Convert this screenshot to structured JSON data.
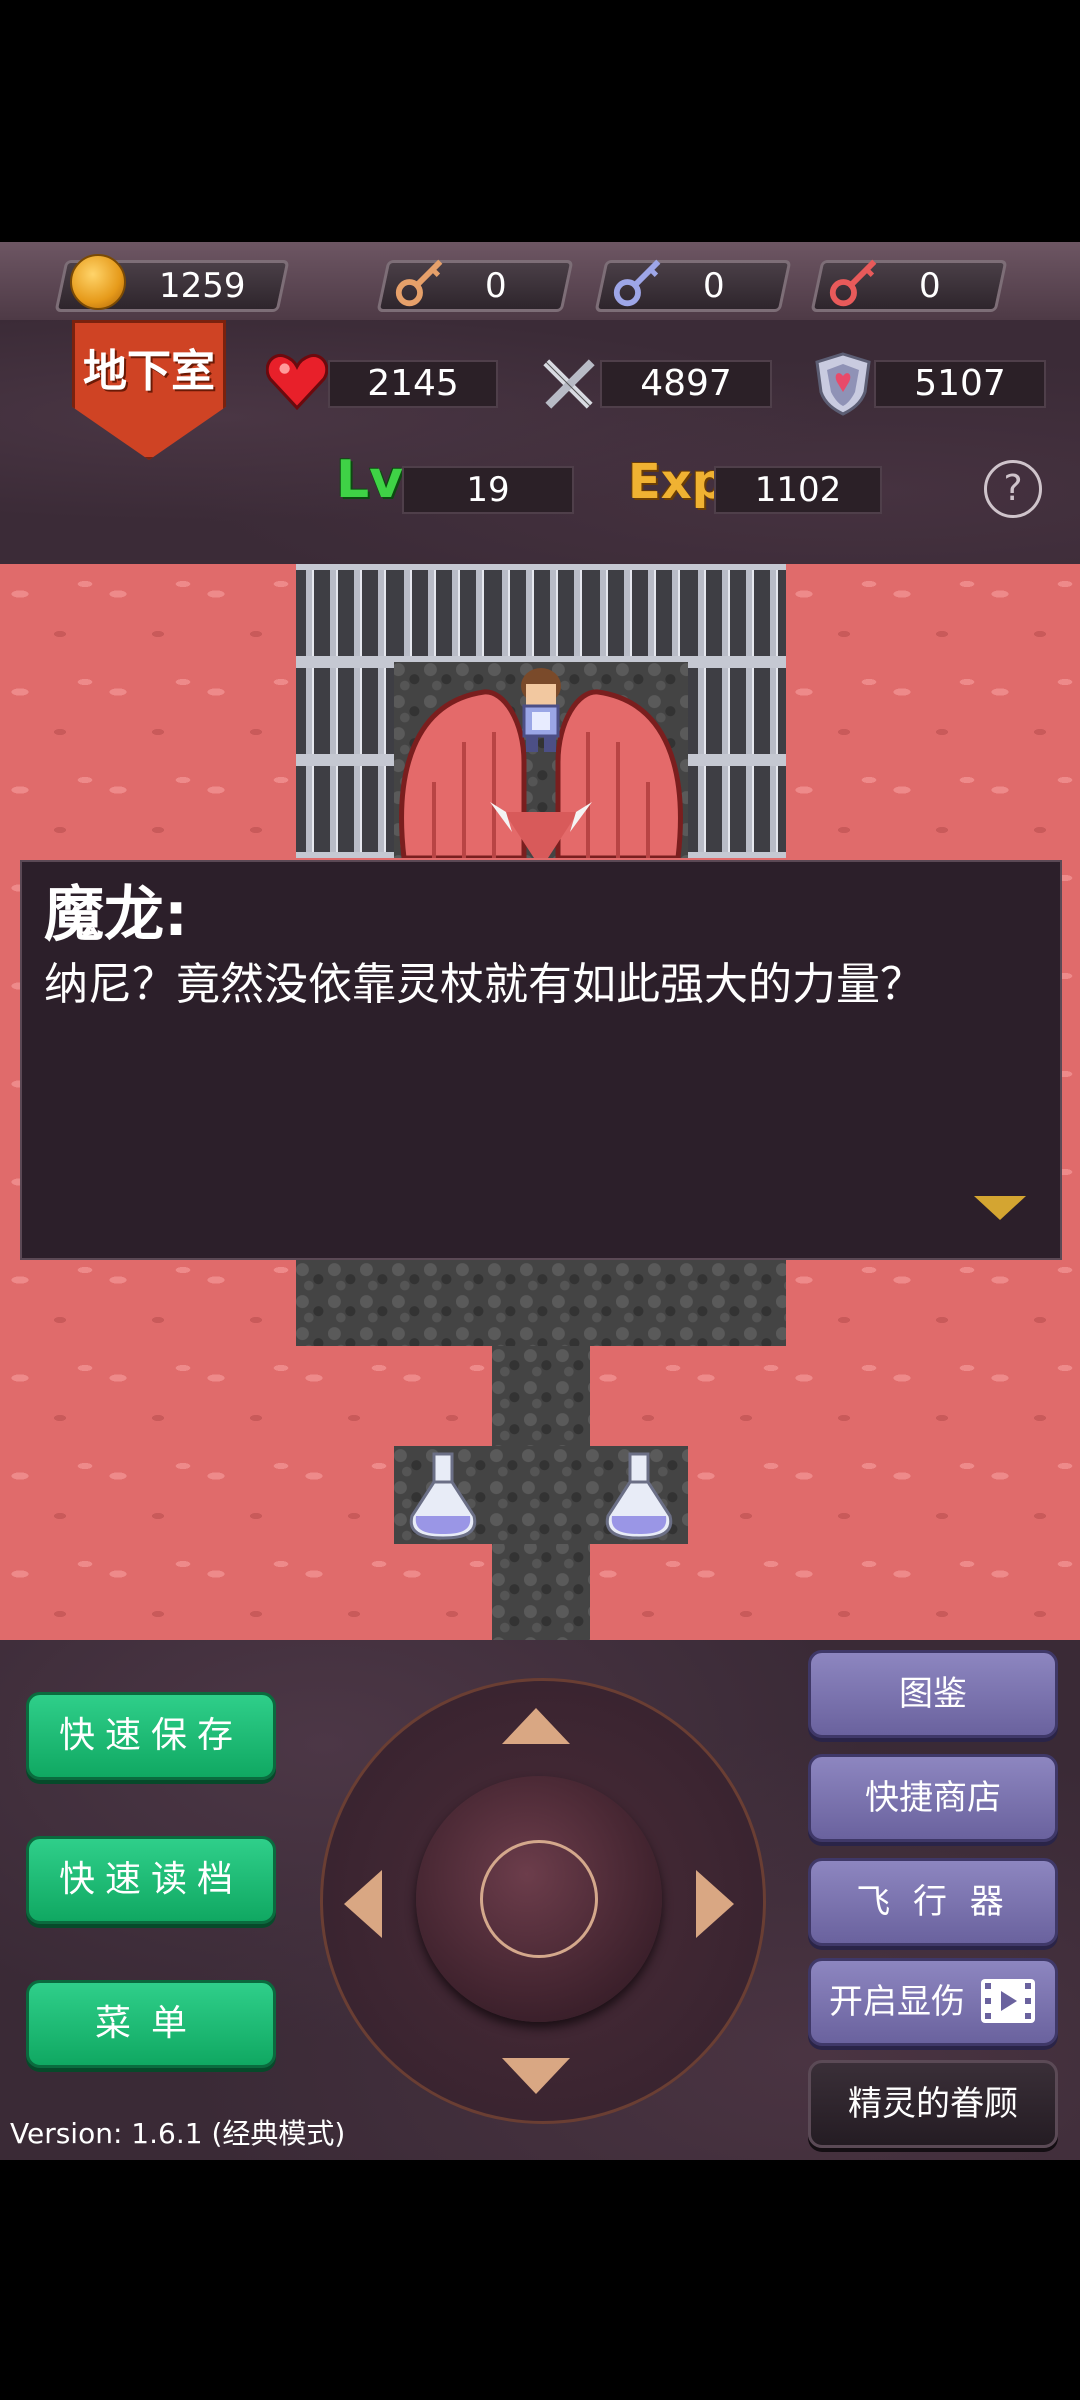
{
  "resources": {
    "gold": "1259",
    "yellow_keys": "0",
    "blue_keys": "0",
    "red_keys": "0"
  },
  "floor": {
    "name": "地下室"
  },
  "stats": {
    "hp": "2145",
    "attack": "4897",
    "defense": "5107",
    "level_label": "Lv",
    "level": "19",
    "exp_label": "Exp",
    "exp": "1102",
    "help": "?"
  },
  "dialog": {
    "speaker": "魔龙:",
    "message": "纳尼？竟然没依靠灵杖就有如此强大的力量？"
  },
  "left_buttons": [
    {
      "label": "快速保存"
    },
    {
      "label": "快速读档"
    },
    {
      "label": "菜单"
    }
  ],
  "right_buttons": [
    {
      "label": "图鉴"
    },
    {
      "label": "快捷商店"
    },
    {
      "label": "飞 行 器"
    },
    {
      "label": "开启显伤"
    },
    {
      "label": "精灵的眷顾"
    }
  ],
  "version": "Version: 1.6.1 (经典模式)",
  "colors": {
    "lava": "#e06b6b",
    "banner": "#cf4324",
    "green_button": "#10a862",
    "purple_button": "#6a629e",
    "dialog_bg": "#2c1f2a"
  }
}
